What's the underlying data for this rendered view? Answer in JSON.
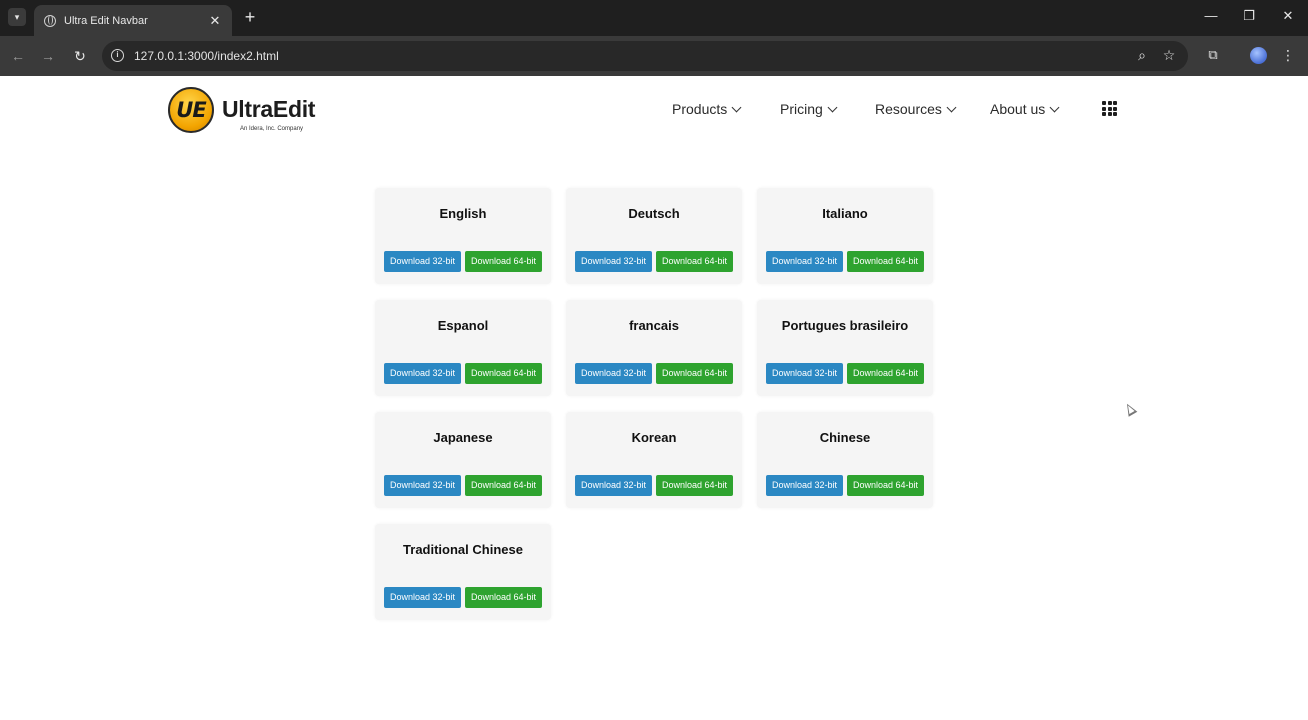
{
  "browser": {
    "tab_title": "Ultra Edit Navbar",
    "tab_close": "✕",
    "new_tab": "+",
    "url": "127.0.0.1:3000/index2.html",
    "icons": [
      "tab-search-icon",
      "globe-icon",
      "close-icon",
      "plus-icon",
      "back-arrow-icon",
      "forward-arrow-icon",
      "reload-icon",
      "site-info-icon",
      "zoom-icon",
      "star-icon",
      "extensions-icon",
      "profile-avatar",
      "kebab-menu-icon",
      "minimize-icon",
      "restore-icon",
      "window-close-icon"
    ]
  },
  "site": {
    "logo_badge": "UE",
    "logo_word": "UltraEdit",
    "logo_tagline": "An Idera, Inc. Company",
    "brand_color": "#f3a400",
    "nav": [
      {
        "label": "Products"
      },
      {
        "label": "Pricing"
      },
      {
        "label": "Resources"
      },
      {
        "label": "About us"
      }
    ],
    "apps_icon": "apps-grid-icon"
  },
  "downloads": {
    "btn32_label": "Download 32-bit",
    "btn64_label": "Download 64-bit",
    "btn32_color": "#2b88c3",
    "btn64_color": "#2ea32f",
    "languages": [
      {
        "name": "English"
      },
      {
        "name": "Deutsch"
      },
      {
        "name": "Italiano"
      },
      {
        "name": "Espanol"
      },
      {
        "name": "francais"
      },
      {
        "name": "Portugues brasileiro"
      },
      {
        "name": "Japanese"
      },
      {
        "name": "Korean"
      },
      {
        "name": "Chinese"
      },
      {
        "name": "Traditional Chinese"
      }
    ]
  }
}
